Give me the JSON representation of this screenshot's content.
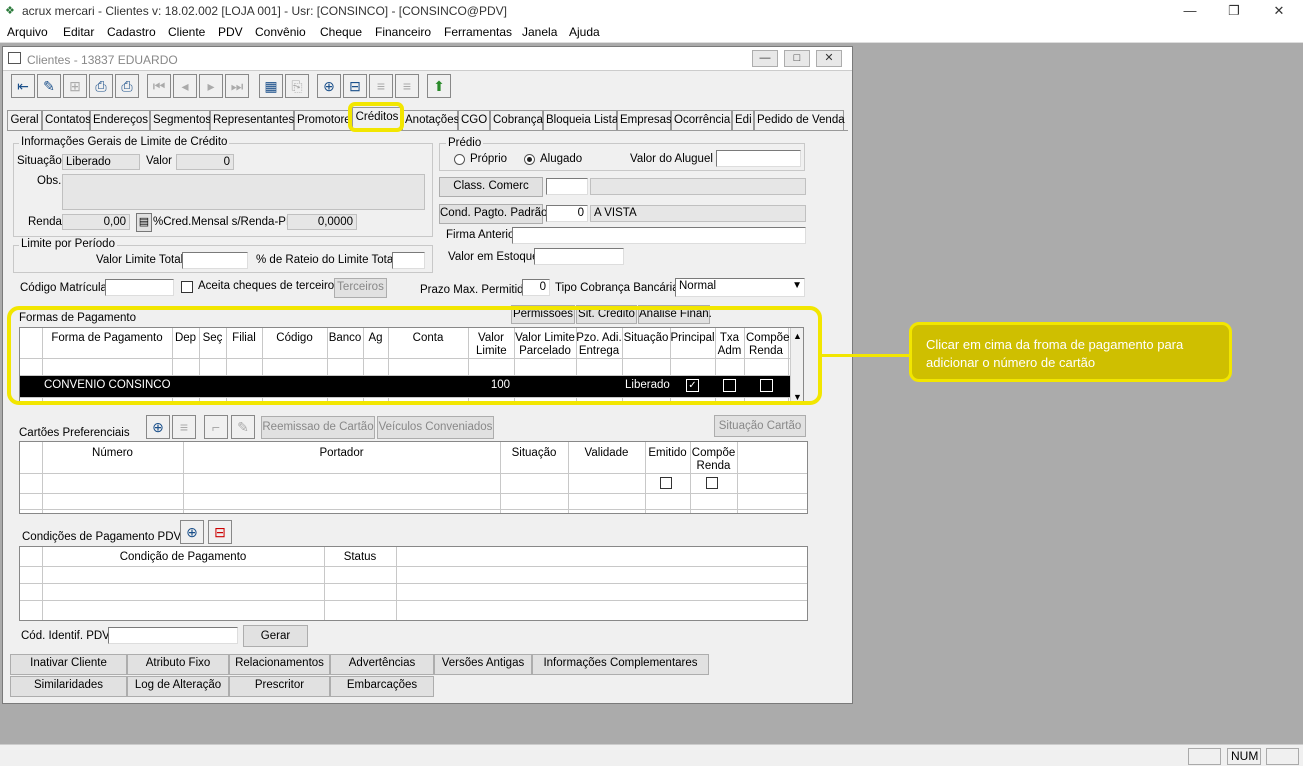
{
  "window": {
    "title": "acrux mercari - Clientes  v: 18.02.002   [LOJA 001] - Usr: [CONSINCO] - [CONSINCO@PDV]",
    "minimize": "—",
    "restore": "❐",
    "close": "✕"
  },
  "menu": [
    "Arquivo",
    "Editar",
    "Cadastro",
    "Cliente",
    "PDV",
    "Convênio",
    "Cheque",
    "Financeiro",
    "Ferramentas",
    "Janela",
    "Ajuda"
  ],
  "child_window": {
    "title": "Clientes - 13837 EDUARDO",
    "minimize": "—",
    "restore": "□",
    "close": "✕"
  },
  "tabs": [
    "Geral",
    "Contatos",
    "Endereços",
    "Segmentos",
    "Representantes",
    "Promotores",
    "Créditos",
    "Anotações",
    "CGO",
    "Cobrança",
    "Bloqueia Lista",
    "Empresas",
    "Ocorrência",
    "Edi",
    "Pedido de Venda"
  ],
  "active_tab": "Créditos",
  "credit_info": {
    "group_title": "Informações Gerais de Limite de Crédito",
    "situacao_label": "Situação",
    "situacao_value": "Liberado",
    "valor_label": "Valor",
    "valor_value": "0",
    "obs_label": "Obs.",
    "renda_label": "Renda",
    "renda_value": "0,00",
    "pct_label": "%Cred.Mensal s/Renda-PF",
    "pct_value": "0,0000"
  },
  "periodo": {
    "group_title": "Limite por Período",
    "valor_limite_label": "Valor Limite Total",
    "rateio_label": "% de Rateio do Limite Total"
  },
  "matricula": {
    "codigo_label": "Código Matrícula",
    "aceita_label": "Aceita cheques de terceiros",
    "terceiros_button": "Terceiros"
  },
  "predio": {
    "group_title": "Prédio",
    "proprio_label": "Próprio",
    "alugado_label": "Alugado",
    "aluguel_label": "Valor do Aluguel",
    "selected": "Alugado"
  },
  "right_fields": {
    "class_comerc_button": "Class. Comerc",
    "cond_pagto_button": "Cond. Pagto. Padrão",
    "cond_pagto_code": "0",
    "cond_pagto_desc": "A VISTA",
    "firma_label": "Firma Anterior",
    "estoque_label": "Valor em Estoque",
    "prazo_label": "Prazo Max. Permitido",
    "prazo_value": "0",
    "tipo_cobranca_label": "Tipo Cobrança Bancária",
    "tipo_cobranca_value": "Normal"
  },
  "payment_forms": {
    "title": "Formas de Pagamento",
    "buttons": [
      "Permissões",
      "Sit. Crédito",
      "Análise Finan."
    ],
    "columns": [
      "Forma de Pagamento",
      "Dep",
      "Seç",
      "Filial",
      "Código",
      "Banco",
      "Ag",
      "Conta",
      "Valor Limite",
      "Valor Limite Parcelado",
      "Pzo. Adi. Entrega",
      "Situação",
      "Principal",
      "Txa Adm",
      "Compõe Renda"
    ],
    "rows": [
      {
        "forma": "CONVENIO CONSINCO",
        "valor_limite": "100",
        "situacao": "Liberado",
        "principal": true,
        "txa_adm": false,
        "compoe_renda": false
      }
    ]
  },
  "cards": {
    "title": "Cartões Preferenciais",
    "reemissao_button": "Reemissao de Cartão",
    "veiculos_button": "Veículos Conveniados",
    "situacao_button": "Situação Cartão",
    "columns": [
      "Número",
      "Portador",
      "Situação",
      "Validade",
      "Emitido",
      "Compõe Renda"
    ]
  },
  "pdv_conditions": {
    "title": "Condições de Pagamento PDV",
    "columns": [
      "Condição de Pagamento",
      "Status"
    ]
  },
  "pdv_id": {
    "label": "Cód. Identif. PDV",
    "gerar_button": "Gerar"
  },
  "bottom_buttons_row1": [
    "Inativar Cliente",
    "Atributo Fixo",
    "Relacionamentos",
    "Advertências",
    "Versões Antigas",
    "Informações Complementares"
  ],
  "bottom_buttons_row2": [
    "Similaridades",
    "Log de Alteração",
    "Prescritor",
    "Embarcações"
  ],
  "callout": "Clicar em cima da froma de pagamento para adicionar o número de cartão",
  "statusbar": {
    "num": "NUM"
  },
  "colors": {
    "highlight": "#f2e600",
    "callout_bg": "#cfbf00",
    "selected_row": "#000000"
  }
}
